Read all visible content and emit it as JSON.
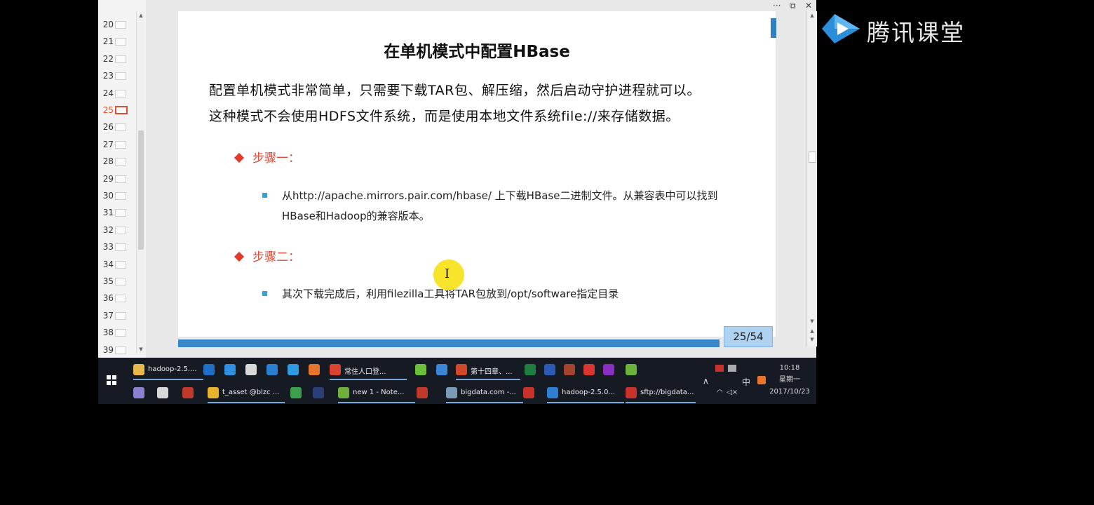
{
  "thumbnails": [
    {
      "num": "20"
    },
    {
      "num": "21"
    },
    {
      "num": "22"
    },
    {
      "num": "23"
    },
    {
      "num": "24"
    },
    {
      "num": "25",
      "active": true
    },
    {
      "num": "26"
    },
    {
      "num": "27"
    },
    {
      "num": "28"
    },
    {
      "num": "29"
    },
    {
      "num": "30"
    },
    {
      "num": "31"
    },
    {
      "num": "32"
    },
    {
      "num": "33"
    },
    {
      "num": "34"
    },
    {
      "num": "35"
    },
    {
      "num": "36"
    },
    {
      "num": "37"
    },
    {
      "num": "38"
    },
    {
      "num": "39"
    }
  ],
  "window_controls": {
    "more": "···",
    "restore": "⧉",
    "close": "✕"
  },
  "slide": {
    "title": "在单机模式中配置HBase",
    "para1": "配置单机模式非常简单，只需要下载TAR包、解压缩，然后启动守护进程就可以。",
    "para2": "这种模式不会使用HDFS文件系统，而是使用本地文件系统file://来存储数据。",
    "step1": {
      "label": "步骤一：",
      "line1": "从http://apache.mirrors.pair.com/hbase/  上下载HBase二进制文件。从兼容表中可以找到",
      "line2": "HBase和Hadoop的兼容版本。"
    },
    "step2": {
      "label": "步骤二：",
      "line1": "其次下载完成后，利用filezilla工具将TAR包放到/opt/software指定目录"
    },
    "cursor_glyph": "I"
  },
  "page_indicator": "25/54",
  "watermark": {
    "text": "腾讯课堂"
  },
  "taskbar": {
    "row1": [
      {
        "label": "hadoop-2.5....",
        "icon": "folder-icon",
        "color": "#e8b84a"
      },
      {
        "label": "",
        "icon": "app-g-icon",
        "color": "#1e6fc9"
      },
      {
        "label": "",
        "icon": "network-icon",
        "color": "#2f8fe0"
      },
      {
        "label": "",
        "icon": "qq-icon",
        "color": "#d8d8d8"
      },
      {
        "label": "",
        "icon": "k-icon",
        "color": "#2a7fd0"
      },
      {
        "label": "",
        "icon": "ie-icon",
        "color": "#2f9ae0"
      },
      {
        "label": "",
        "icon": "firefox-icon",
        "color": "#e8752a"
      },
      {
        "label": "常住人口登...",
        "icon": "chrome-icon",
        "color": "#d9432f"
      },
      {
        "label": "",
        "icon": "sync-icon",
        "color": "#6bbf3a"
      },
      {
        "label": "",
        "icon": "mail-icon",
        "color": "#3a86d8"
      },
      {
        "label": "第十四章、...",
        "icon": "powerpoint-icon",
        "color": "#d2472a"
      },
      {
        "label": "",
        "icon": "excel-icon",
        "color": "#1e7e3e"
      },
      {
        "label": "",
        "icon": "word-icon",
        "color": "#2b5bb5"
      },
      {
        "label": "",
        "icon": "winrar-icon",
        "color": "#a3452c"
      },
      {
        "label": "",
        "icon": "xshell-icon",
        "color": "#d8362f"
      },
      {
        "label": "",
        "icon": "axure-icon",
        "color": "#8a2fc0"
      },
      {
        "label": "",
        "icon": "green-app-icon",
        "color": "#6ab23a"
      }
    ],
    "row2": [
      {
        "label": "",
        "icon": "globe-icon",
        "color": "#8a7fd0"
      },
      {
        "label": "",
        "icon": "coffee-icon",
        "color": "#d8d8d8"
      },
      {
        "label": "",
        "icon": "winrar2-icon",
        "color": "#c0392b"
      },
      {
        "label": "t_asset @blzc ...",
        "icon": "navicat-icon",
        "color": "#e8b32a"
      },
      {
        "label": "",
        "icon": "pycharm-icon",
        "color": "#3aa04a"
      },
      {
        "label": "",
        "icon": "intellij-icon",
        "color": "#2b3e78"
      },
      {
        "label": "new  1 - Note...",
        "icon": "notepad-icon",
        "color": "#6fb03a"
      },
      {
        "label": "",
        "icon": "paint-icon",
        "color": "#c0392b"
      },
      {
        "label": "bigdata.com -...",
        "icon": "terminal-icon",
        "color": "#7a9ab8"
      },
      {
        "label": "",
        "icon": "filezilla-icon",
        "color": "#c8322a"
      },
      {
        "label": "hadoop-2.5.0...",
        "icon": "app-blue-icon",
        "color": "#2f7fd0"
      },
      {
        "label": "sftp://bigdata...",
        "icon": "filezilla2-icon",
        "color": "#c8322a"
      }
    ],
    "tray": {
      "chevron": "∧",
      "ime": "中",
      "sound": "◁×",
      "time": "10:18",
      "weekday": "星期一",
      "date": "2017/10/23"
    }
  }
}
